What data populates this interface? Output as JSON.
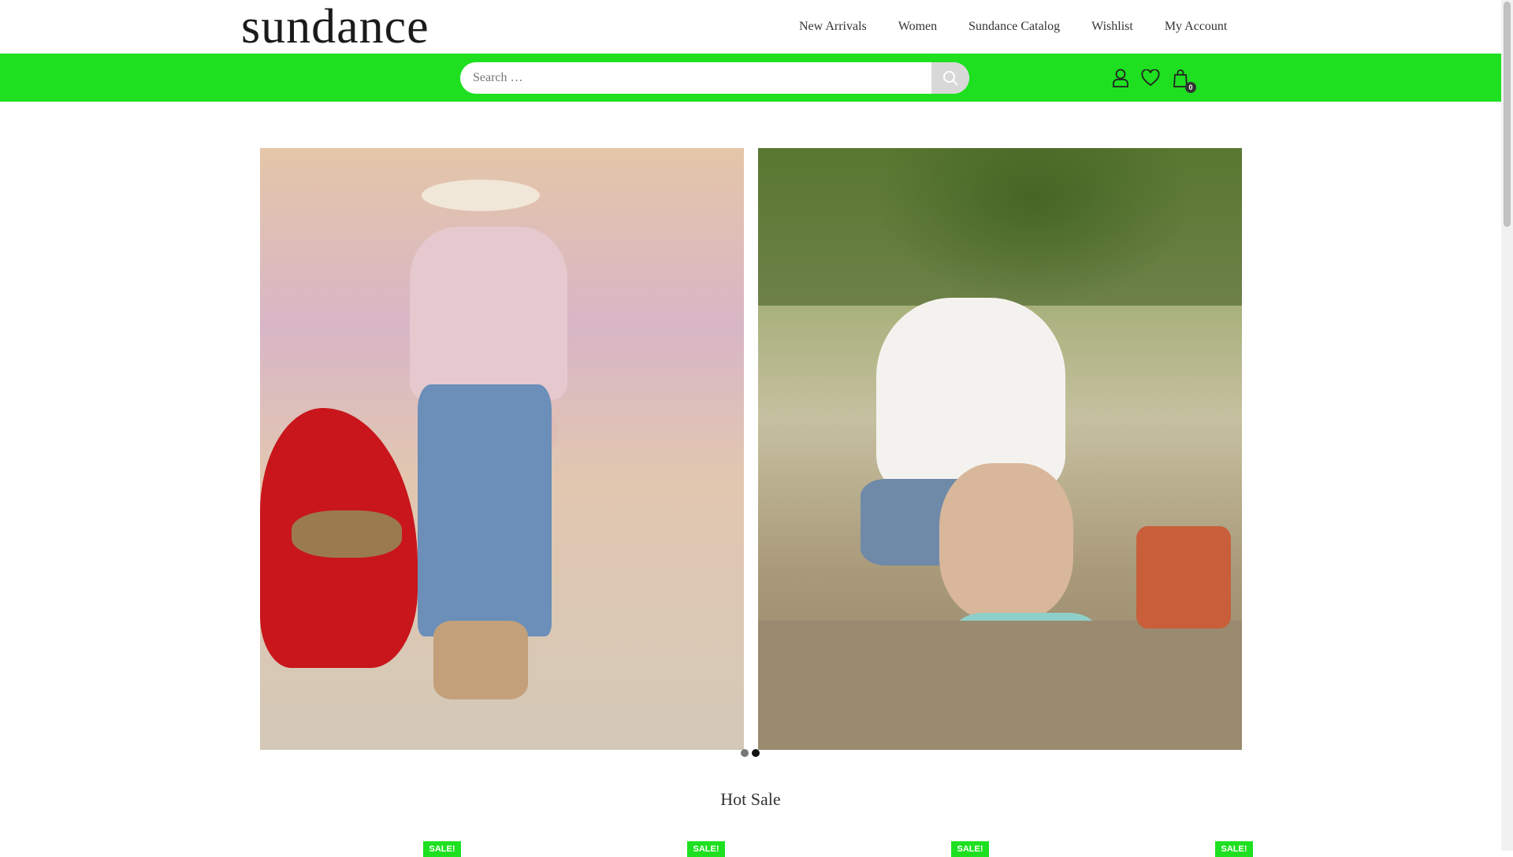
{
  "header": {
    "logo": "sundance",
    "nav": [
      "New Arrivals",
      "Women",
      "Sundance Catalog",
      "Wishlist",
      "My Account"
    ]
  },
  "search": {
    "placeholder": "Search …"
  },
  "cart": {
    "count": "0"
  },
  "hero": {
    "slide_count": 2,
    "active_slide": 2
  },
  "hot_sale": {
    "title": "Hot Sale",
    "badge": "SALE!"
  },
  "colors": {
    "accent": "#1ee020",
    "text": "#333333"
  },
  "icons": [
    "search-icon",
    "user-icon",
    "heart-icon",
    "shopping-bag-icon"
  ]
}
